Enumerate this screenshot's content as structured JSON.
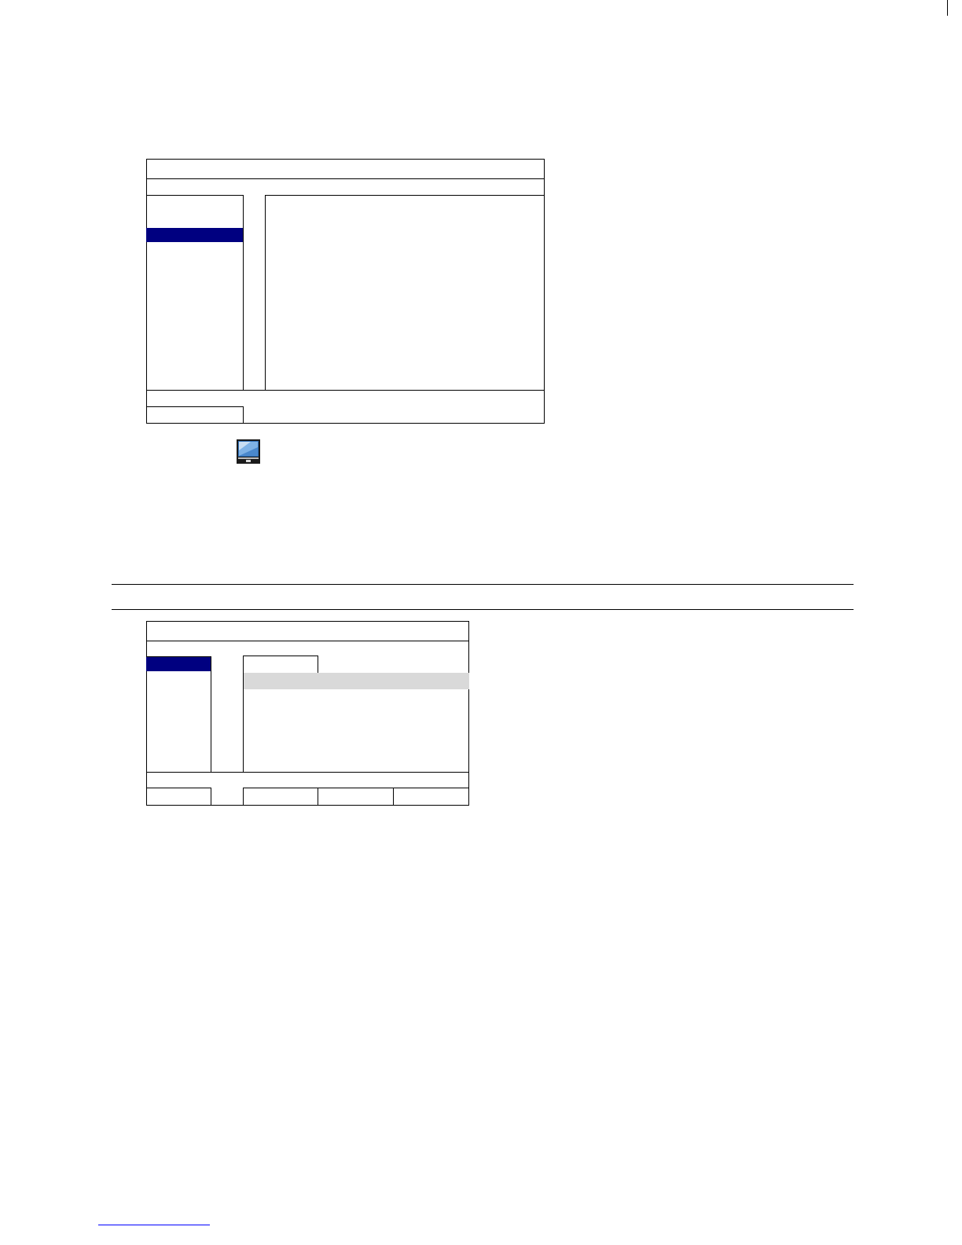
{
  "colors": {
    "selection": "#000080",
    "row_highlight": "#d9d9d9",
    "border": "#000000",
    "page": "#ffffff"
  },
  "icons": {
    "menu_icon": "monitor-icon"
  }
}
